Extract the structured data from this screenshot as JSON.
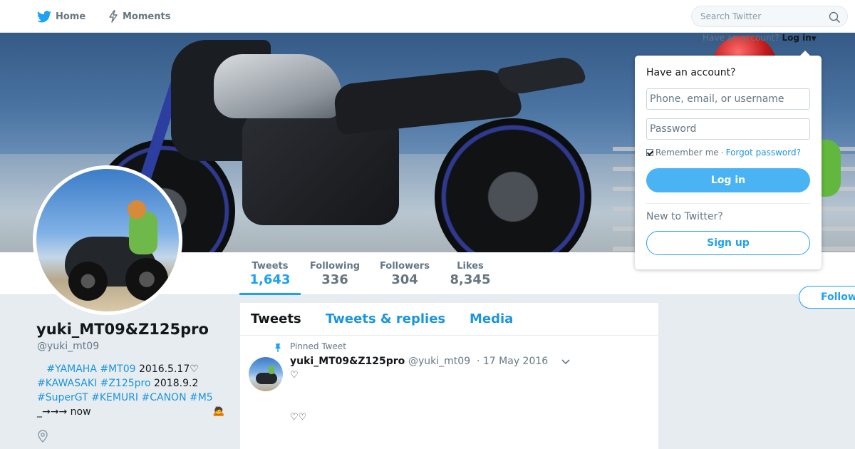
{
  "nav": {
    "home_label": "Home",
    "moments_label": "Moments",
    "search_placeholder": "Search Twitter"
  },
  "account_prompt": {
    "text": "Have an account?",
    "login_label": "Log in"
  },
  "profile": {
    "full_name": "yuki_MT09&Z125pro",
    "screen_name": "@yuki_mt09",
    "bio": {
      "line1_tags": "#YAMAHA #MT09",
      "line1_text": " 2016.5.17♡",
      "line2_tags": "#KAWASAKI #Z125pro",
      "line2_text": " 2018.9.2",
      "line3_tags": "#SuperGT #KEMURI #CANON #M5",
      "line4_text": "_→→→ now",
      "emoji": "🙇"
    }
  },
  "stats": {
    "tweets": {
      "label": "Tweets",
      "value": "1,643"
    },
    "following": {
      "label": "Following",
      "value": "336"
    },
    "followers": {
      "label": "Followers",
      "value": "304"
    },
    "likes": {
      "label": "Likes",
      "value": "8,345"
    }
  },
  "follow_label": "Follow",
  "timeline": {
    "tabs": [
      "Tweets",
      "Tweets & replies",
      "Media"
    ],
    "pinned_label": "Pinned Tweet",
    "tweet": {
      "name": "yuki_MT09&Z125pro",
      "handle": "@yuki_mt09",
      "date": "· 17 May 2016",
      "line1": "♡",
      "line2": "♡♡"
    }
  },
  "login_box": {
    "title": "Have an account?",
    "user_placeholder": "Phone, email, or username",
    "password_placeholder": "Password",
    "remember_label": "Remember me",
    "separator": "·",
    "forgot_label": "Forgot password?",
    "login_button": "Log in",
    "new_prompt": "New to Twitter?",
    "signup_button": "Sign up"
  },
  "colors": {
    "accent": "#1da1f2",
    "link": "#1b95e0",
    "background": "#e6ecf0"
  }
}
